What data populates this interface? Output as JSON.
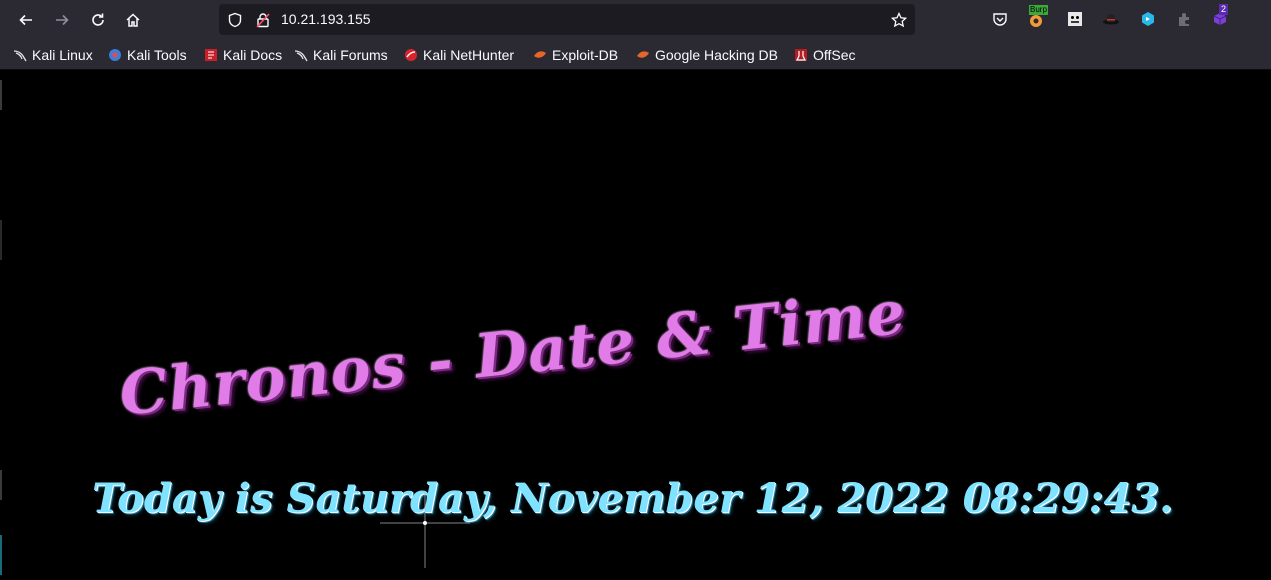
{
  "browser": {
    "url": "10.21.193.155",
    "extensions": {
      "burp_badge": "Burp",
      "notification_count": "2"
    },
    "bookmarks": [
      {
        "label": "Kali Linux"
      },
      {
        "label": "Kali Tools"
      },
      {
        "label": "Kali Docs"
      },
      {
        "label": "Kali Forums"
      },
      {
        "label": "Kali NetHunter"
      },
      {
        "label": "Exploit-DB"
      },
      {
        "label": "Google Hacking DB"
      },
      {
        "label": "OffSec"
      }
    ]
  },
  "page": {
    "title": "Chronos - Date & Time",
    "datetime": "Today is Saturday, November 12, 2022 08:29:43."
  },
  "colors": {
    "chrome_bg": "#2b2a33",
    "urlbar_bg": "#1c1b22",
    "title_color": "#e07be8",
    "datetime_color": "#7fe3ff"
  }
}
